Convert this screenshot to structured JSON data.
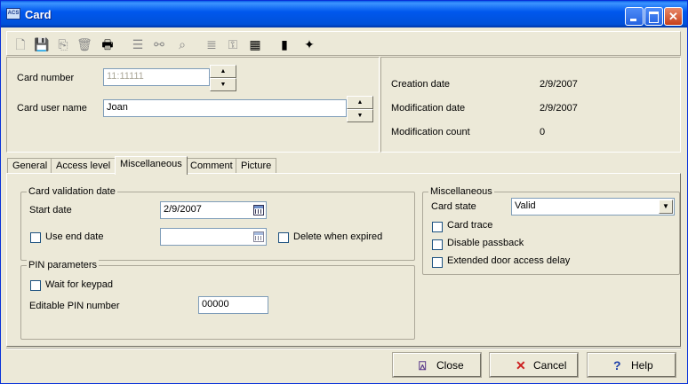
{
  "window": {
    "title": "Card",
    "app_icon_text": "ACS"
  },
  "toolbar": {
    "items": [
      {
        "icon": "new-icon",
        "glyph": "🗋",
        "active": false
      },
      {
        "icon": "save-icon",
        "glyph": "💾",
        "active": true
      },
      {
        "icon": "copy-icon",
        "glyph": "⎘",
        "active": false
      },
      {
        "icon": "delete-icon",
        "glyph": "🗑",
        "active": false
      },
      {
        "icon": "print-icon",
        "glyph": "🖶",
        "active": true
      },
      {
        "icon": "list-icon",
        "glyph": "☰",
        "active": false
      },
      {
        "icon": "link-icon",
        "glyph": "⚯",
        "active": false
      },
      {
        "icon": "find-icon",
        "glyph": "⌕",
        "active": false
      },
      {
        "icon": "details-icon",
        "glyph": "≣",
        "active": false
      },
      {
        "icon": "key-icon",
        "glyph": "⚿",
        "active": false
      },
      {
        "icon": "grid-icon",
        "glyph": "▦",
        "active": true
      },
      {
        "icon": "film-icon",
        "glyph": "▮",
        "active": true
      },
      {
        "icon": "card-icon",
        "glyph": "✦",
        "active": true
      }
    ]
  },
  "header": {
    "card_number_label": "Card number",
    "card_number_value": "11:11111",
    "card_user_name_label": "Card user name",
    "card_user_name_value": "Joan",
    "creation_date_label": "Creation date",
    "creation_date_value": "2/9/2007",
    "modification_date_label": "Modification date",
    "modification_date_value": "2/9/2007",
    "modification_count_label": "Modification count",
    "modification_count_value": "0"
  },
  "tabs": [
    {
      "label": "General"
    },
    {
      "label": "Access level"
    },
    {
      "label": "Miscellaneous"
    },
    {
      "label": "Comment"
    },
    {
      "label": "Picture"
    }
  ],
  "validation": {
    "group_label": "Card validation date",
    "start_date_label": "Start date",
    "start_date_value": "2/9/2007",
    "use_end_date_label": "Use end date",
    "end_date_value": "",
    "delete_when_expired_label": "Delete when expired"
  },
  "pin": {
    "group_label": "PIN parameters",
    "wait_for_keypad_label": "Wait for keypad",
    "editable_pin_label": "Editable PIN number",
    "editable_pin_value": "00000"
  },
  "misc": {
    "group_label": "Miscellaneous",
    "card_state_label": "Card state",
    "card_state_value": "Valid",
    "card_trace_label": "Card trace",
    "disable_passback_label": "Disable passback",
    "extended_door_label": "Extended door access delay"
  },
  "buttons": {
    "close_label": "Close",
    "cancel_label": "Cancel",
    "help_label": "Help"
  },
  "colors": {
    "title_bar": "#0058ee",
    "face": "#ece9d8",
    "close_x": "#cc1f1f",
    "help_q": "#1c3ea8"
  }
}
